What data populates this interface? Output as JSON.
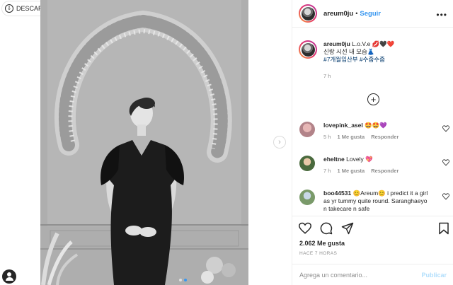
{
  "media": {
    "download_label": "DESCARGAR",
    "carousel_count": 2,
    "carousel_active": 2
  },
  "header": {
    "username": "areum0ju",
    "separator": "•",
    "follow_label": "Seguir"
  },
  "caption": {
    "username": "areum0ju",
    "text": "L.o.V.e 💋🖤❤️",
    "line2": "신랑 시선 내 모습👗",
    "hashtags": "#7개월임산부 #수줍수줍",
    "time": "7 h"
  },
  "comments": [
    {
      "username": "lovepink_asel",
      "text": "🤩🤩💜",
      "time": "5 h",
      "likes": "1 Me gusta",
      "reply": "Responder"
    },
    {
      "username": "eheltne",
      "text": "Lovely 💖",
      "time": "7 h",
      "likes": "1 Me gusta",
      "reply": "Responder"
    },
    {
      "username": "boo44531",
      "text": "😊Areum😊 i predict it a girl as yr tummy quite round. Saranghaeyo n takecare n safe",
      "time": "",
      "likes": "",
      "reply": ""
    }
  ],
  "actions": {
    "likes": "2.062 Me gusta",
    "ago": "HACE 7 HORAS"
  },
  "comment_box": {
    "placeholder": "Agrega un comentario...",
    "publish_label": "Publicar"
  },
  "colors": {
    "accent": "#3897f0",
    "publish_disabled": "#b2dffc",
    "hashtag": "#00376b",
    "muted": "#8e8e8e"
  }
}
